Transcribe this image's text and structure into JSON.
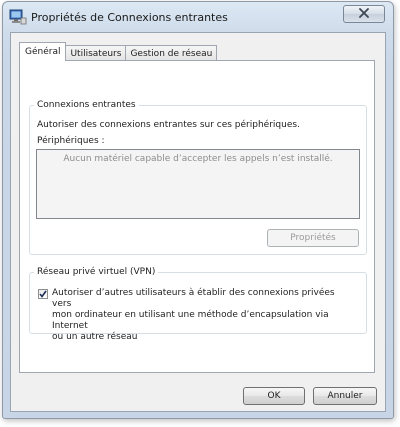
{
  "window": {
    "title": "Propriétés de Connexions entrantes",
    "close_icon": "close-x-icon",
    "app_icon": "network-computer-icon"
  },
  "tabs": [
    {
      "label": "Général",
      "active": true
    },
    {
      "label": "Utilisateurs",
      "active": false
    },
    {
      "label": "Gestion de réseau",
      "active": false
    }
  ],
  "incoming": {
    "group_label": "Connexions entrantes",
    "description": "Autoriser des connexions entrantes sur ces périphériques.",
    "devices_label": "Périphériques :",
    "empty_message": "Aucun matériel capable d’accepter les appels n’est installé.",
    "properties_button": "Propriétés",
    "properties_enabled": false
  },
  "vpn": {
    "group_label": "Réseau privé virtuel (VPN)",
    "checkbox_checked": true,
    "checkbox_line1": "Autoriser d’autres utilisateurs à établir des connexions privées vers",
    "checkbox_line2": "mon ordinateur en utilisant une méthode d’encapsulation via Internet",
    "checkbox_line3": "ou un autre réseau"
  },
  "footer": {
    "ok_label": "OK",
    "cancel_label": "Annuler"
  }
}
